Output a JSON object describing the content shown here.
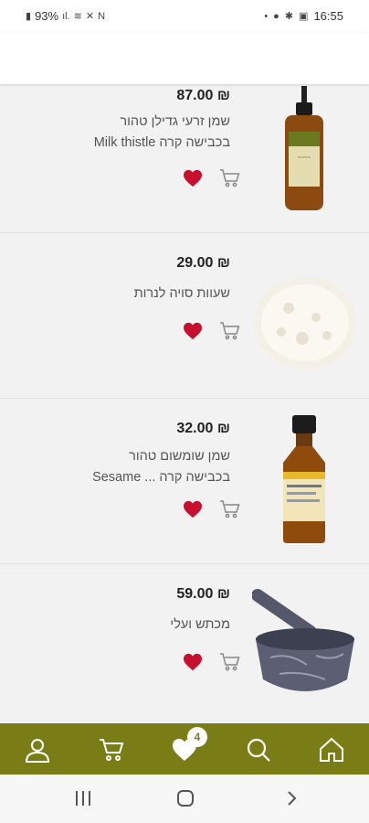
{
  "status_bar": {
    "battery": "93%",
    "time": "16:55"
  },
  "products": [
    {
      "price": "₪ 87.00",
      "name_line1": "שמן זרעי גדילן טהור",
      "name_line2": "בכבישה קרה Milk thistle",
      "favorite": true,
      "image": "amber-dropper-bottle-image"
    },
    {
      "price": "₪ 29.00",
      "name_line1": "שעוות סויה לנרות",
      "name_line2": "",
      "favorite": true,
      "image": "soy-wax-flakes-image"
    },
    {
      "price": "₪ 32.00",
      "name_line1": "שמן שומשום טהור",
      "name_line2": "בכבישה קרה ... Sesame",
      "favorite": true,
      "image": "amber-oil-bottle-image"
    },
    {
      "price": "₪ 59.00",
      "name_line1": "מכתש ועלי",
      "name_line2": "",
      "favorite": true,
      "image": "marble-mortar-pestle-image"
    }
  ],
  "bottom_nav": {
    "favorites_badge": "4"
  },
  "colors": {
    "brand": "#7a7d16",
    "heart": "#c8102e",
    "list_bg": "#f2f2f2"
  }
}
